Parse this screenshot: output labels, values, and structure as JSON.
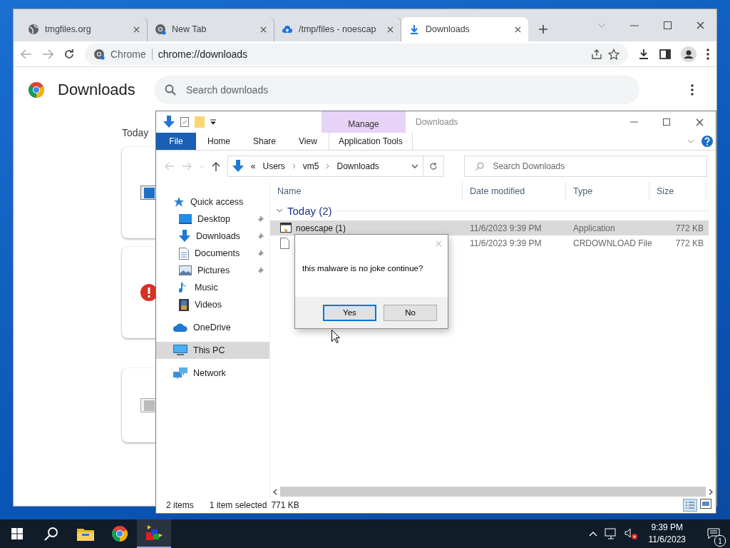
{
  "browser": {
    "tabs": [
      {
        "title": "tmgfiles.org",
        "kind": "globe",
        "selected": false
      },
      {
        "title": "New Tab",
        "kind": "chrome",
        "selected": false
      },
      {
        "title": "/tmp/files - noescap",
        "kind": "cloud",
        "selected": false
      },
      {
        "title": "Downloads",
        "kind": "download",
        "selected": true
      }
    ],
    "omnibox": {
      "chip": "Chrome",
      "url": "chrome://downloads"
    },
    "page": {
      "title": "Downloads",
      "search_placeholder": "Search downloads",
      "section": "Today",
      "cards": [
        {
          "kind": "file"
        },
        {
          "kind": "error"
        },
        {
          "kind": "removed"
        }
      ]
    }
  },
  "explorer": {
    "context_header": "Manage",
    "title": "Downloads",
    "ribbon_tabs": [
      {
        "label": "File",
        "kind": "file"
      },
      {
        "label": "Home",
        "kind": "normal"
      },
      {
        "label": "Share",
        "kind": "normal"
      },
      {
        "label": "View",
        "kind": "normal"
      },
      {
        "label": "Application Tools",
        "kind": "contextual"
      }
    ],
    "address": {
      "overflow": "«",
      "path": [
        "Users",
        "vm5",
        "Downloads"
      ]
    },
    "search_placeholder": "Search Downloads",
    "nav": [
      {
        "label": "Quick access",
        "kind": "star",
        "selected": false,
        "children": [
          {
            "label": "Desktop",
            "kind": "desktop",
            "pinned": true,
            "selected": false
          },
          {
            "label": "Downloads",
            "kind": "download",
            "pinned": true,
            "selected": false
          },
          {
            "label": "Documents",
            "kind": "document",
            "pinned": true,
            "selected": false
          },
          {
            "label": "Pictures",
            "kind": "pictures",
            "pinned": true,
            "selected": false
          },
          {
            "label": "Music",
            "kind": "music",
            "pinned": false,
            "selected": false
          },
          {
            "label": "Videos",
            "kind": "videos",
            "pinned": false,
            "selected": false
          }
        ]
      },
      {
        "label": "OneDrive",
        "kind": "cloud",
        "selected": false
      },
      {
        "label": "This PC",
        "kind": "pc",
        "selected": true
      },
      {
        "label": "Network",
        "kind": "network",
        "selected": false
      }
    ],
    "columns": [
      "Name",
      "Date modified",
      "Type",
      "Size"
    ],
    "group": "Today (2)",
    "rows": [
      {
        "name": "noescape (1)",
        "kind": "app",
        "date": "11/6/2023 9:39 PM",
        "type": "Application",
        "size": "772 KB",
        "selected": true
      },
      {
        "kind": "file",
        "date": "11/6/2023 9:39 PM",
        "type": "CRDOWNLOAD File",
        "size": "772 KB",
        "selected": false
      }
    ],
    "status": {
      "count": "2 items",
      "selection": "1 item selected",
      "size": "771 KB"
    }
  },
  "dialog": {
    "message": "this malware is no joke continue?",
    "buttons": [
      {
        "label": "Yes",
        "default": true
      },
      {
        "label": "No",
        "default": false
      }
    ]
  },
  "taskbar": {
    "apps": [
      {
        "kind": "explorer",
        "active": false
      },
      {
        "kind": "chrome",
        "active": false
      },
      {
        "kind": "blocks",
        "active": true
      }
    ],
    "time": "9:39 PM",
    "date": "11/6/2023",
    "notifications": "1"
  }
}
